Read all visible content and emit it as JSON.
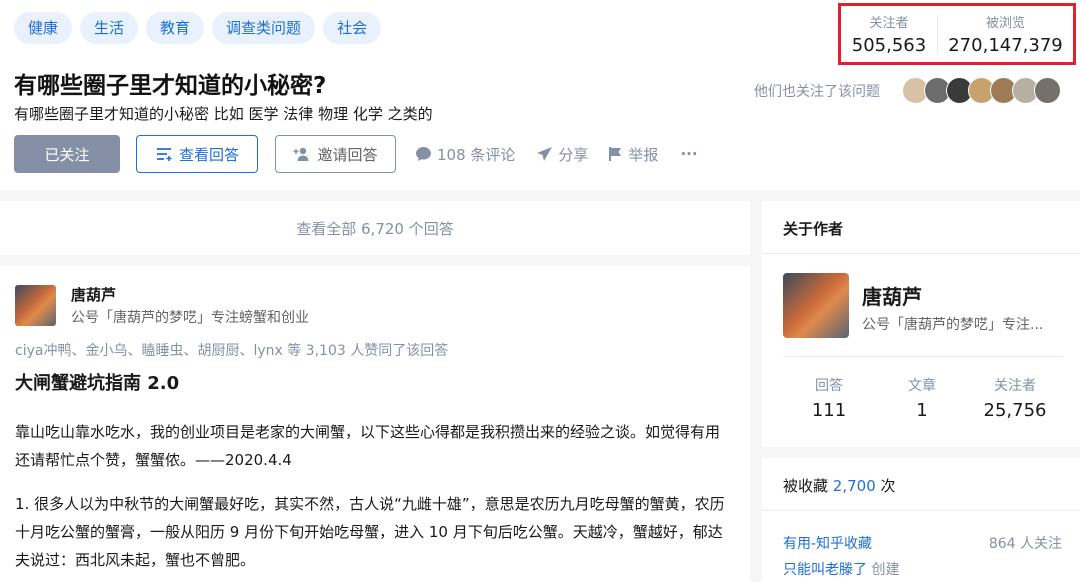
{
  "tags": [
    "健康",
    "生活",
    "教育",
    "调查类问题",
    "社会"
  ],
  "question": {
    "title": "有哪些圈子里才知道的小秘密?",
    "description": "有哪些圈子里才知道的小秘密 比如 医学 法律 物理 化学 之类的"
  },
  "actions": {
    "followed_label": "已关注",
    "view_answers_label": "查看回答",
    "invite_label": "邀请回答",
    "comments_label": "108 条评论",
    "share_label": "分享",
    "report_label": "举报",
    "more_label": "···"
  },
  "stats": {
    "followers_label": "关注者",
    "followers_value": "505,563",
    "views_label": "被浏览",
    "views_value": "270,147,379"
  },
  "also_follow_text": "他们也关注了该问题",
  "view_all_answers": "查看全部 6,720 个回答",
  "answer": {
    "author_name": "唐葫芦",
    "author_bio": "公号「唐葫芦的梦呓」专注螃蟹和创业",
    "voters": "ciya冲鸭、金小乌、瞌睡虫、胡厨厨、lynx 等 3,103 人赞同了该回答",
    "heading": "大闸蟹避坑指南 2.0",
    "para1": "靠山吃山靠水吃水，我的创业项目是老家的大闸蟹，以下这些心得都是我积攒出来的经验之谈。如觉得有用还请帮忙点个赞，蟹蟹侬。——2020.4.4",
    "para2": "1. 很多人以为中秋节的大闸蟹最好吃，其实不然，古人说“九雌十雄”，意思是农历九月吃母蟹的蟹黄，农历十月吃公蟹的蟹膏，一般从阳历 9 月份下旬开始吃母蟹，进入 10 月下旬后吃公蟹。天越冷，蟹越好，郁达夫说过：西北风未起，蟹也不曾肥。"
  },
  "about_author": {
    "title": "关于作者",
    "name": "唐葫芦",
    "bio": "公号「唐葫芦的梦呓」专注...",
    "answers_label": "回答",
    "answers_value": "111",
    "articles_label": "文章",
    "articles_value": "1",
    "followers_label": "关注者",
    "followers_value": "25,756"
  },
  "collected": {
    "prefix": "被收藏",
    "count": "2,700",
    "suffix": "次",
    "collection_name": "有用-知乎收藏",
    "collection_followers": "864 人关注",
    "creator_name": "只能叫老滕了",
    "creator_suffix": "创建"
  },
  "colors": {
    "accent": "#1e6fd9",
    "highlight_border": "#e0202a",
    "muted": "#8590a6"
  }
}
